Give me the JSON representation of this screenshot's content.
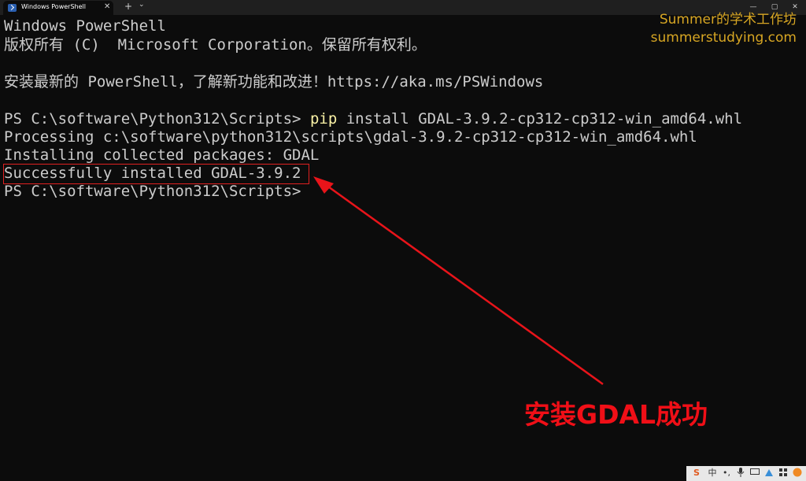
{
  "window": {
    "tab_title": "Windows PowerShell",
    "tab_close": "✕",
    "new_tab": "+",
    "dropdown": "⌄",
    "minimize": "—",
    "maximize": "▢",
    "close": "✕"
  },
  "terminal": {
    "lines": [
      "Windows PowerShell",
      "版权所有 (C)  Microsoft Corporation。保留所有权利。",
      "",
      "安装最新的 PowerShell，了解新功能和改进！https://aka.ms/PSWindows",
      "",
      "PS C:\\software\\Python312\\Scripts> ",
      "Processing c:\\software\\python312\\scripts\\gdal-3.9.2-cp312-cp312-win_amd64.whl",
      "Installing collected packages: GDAL",
      "Successfully installed GDAL-3.9.2",
      "PS C:\\software\\Python312\\Scripts>"
    ],
    "command_keyword": "pip",
    "command_args": " install GDAL-3.9.2-cp312-cp312-win_amd64.whl"
  },
  "watermark": {
    "line1": "Summer的学术工作坊",
    "line2": "summerstudying.com"
  },
  "annotation": {
    "text": "安装GDAL成功",
    "color": "#f00f17"
  },
  "tray": {
    "ime": "中",
    "items": [
      "S",
      "中",
      "•,",
      "mic-icon",
      "keyboard-icon",
      "skin-icon",
      "grid-icon",
      "pet-icon"
    ]
  },
  "colors": {
    "background": "#0c0c0c",
    "text": "#cccccc",
    "command": "#f9f1a5",
    "watermark": "#d7a623",
    "highlight": "#e02020"
  }
}
